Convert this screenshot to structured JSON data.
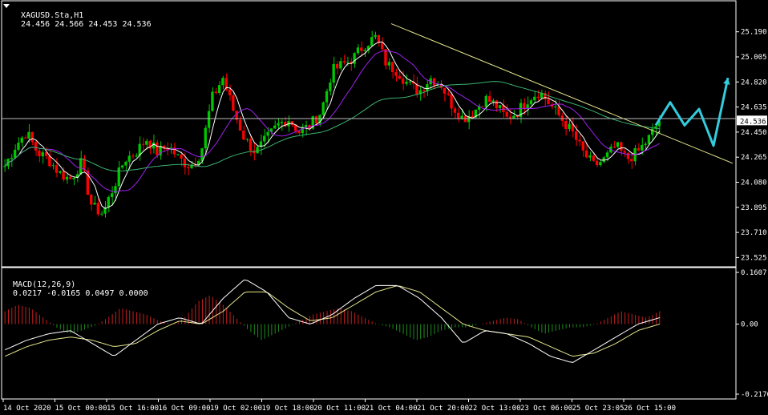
{
  "header": {
    "symbol": "XAGUSD.Sta,H1",
    "ohlc": "24.456 24.566 24.453 24.536"
  },
  "macd_header": {
    "label": "MACD(12,26,9)",
    "values": "0.0217 -0.0165 0.0497 0.0000"
  },
  "colors": {
    "background": "#000000",
    "bull_candle": "#00c800",
    "bear_candle": "#ff0000",
    "ma_fast": "#ffffff",
    "ma_mid": "#a020f0",
    "ma_slow": "#3cb371",
    "trendline": "#e6e68c",
    "forecast_arrow": "#33ccdd",
    "macd_hist_pos": "#c81e1e",
    "macd_hist_neg": "#1e8c1e",
    "macd_line": "#ffffff",
    "signal_line": "#e6e68c",
    "grid_axis": "#ffffff"
  },
  "chart_data": [
    {
      "type": "candlestick",
      "title": "XAGUSD.Sta,H1",
      "ylim": [
        23.48,
        25.33
      ],
      "yticks": [
        "25.190",
        "25.005",
        "24.820",
        "24.635",
        "24.450",
        "24.265",
        "24.080",
        "23.895",
        "23.710",
        "23.525"
      ],
      "current_price": "24.536",
      "close_path": [
        24.2,
        24.35,
        24.45,
        24.3,
        24.25,
        24.15,
        24.1,
        24.22,
        23.9,
        23.85,
        24.05,
        24.25,
        24.3,
        24.4,
        24.3,
        24.35,
        24.25,
        24.2,
        24.3,
        24.7,
        24.85,
        24.6,
        24.4,
        24.3,
        24.4,
        24.5,
        24.55,
        24.45,
        24.5,
        24.6,
        24.9,
        24.95,
        25.0,
        25.1,
        25.15,
        24.95,
        24.9,
        24.8,
        24.75,
        24.85,
        24.8,
        24.65,
        24.55,
        24.6,
        24.7,
        24.65,
        24.55,
        24.6,
        24.7,
        24.75,
        24.65,
        24.55,
        24.45,
        24.3,
        24.2,
        24.25,
        24.35,
        24.25,
        24.3,
        24.4,
        24.536
      ],
      "moving_averages": [
        "ma_fast",
        "ma_mid",
        "ma_slow"
      ],
      "trendline": {
        "from": [
          "21 Oct 04:00",
          25.25
        ],
        "to": [
          "26 Oct 15:00+",
          24.22
        ]
      },
      "horizontal_line": 24.55,
      "forecast_zigzag": [
        24.5,
        24.67,
        24.5,
        24.62,
        24.35,
        24.85
      ]
    },
    {
      "type": "bar",
      "title": "MACD(12,26,9)",
      "ylim": [
        -0.2176,
        0.1607
      ],
      "yticks": [
        "0.1607",
        "0.00",
        "-0.2176"
      ],
      "histogram": [
        0.04,
        0.06,
        0.05,
        0.02,
        -0.01,
        -0.03,
        -0.02,
        -0.005,
        0.02,
        0.05,
        0.04,
        0.03,
        0.01,
        0.0,
        0.02,
        0.07,
        0.09,
        0.06,
        0.02,
        -0.02,
        -0.05,
        -0.03,
        -0.01,
        0.01,
        0.03,
        0.04,
        0.05,
        0.04,
        0.02,
        0.0,
        -0.01,
        -0.03,
        -0.05,
        -0.04,
        -0.02,
        -0.01,
        -0.01,
        0.0,
        0.01,
        0.02,
        0.015,
        -0.01,
        -0.03,
        -0.02,
        -0.01,
        -0.01,
        0.0,
        0.02,
        0.04,
        0.03,
        0.02,
        0.04
      ],
      "macd_line": [
        -0.08,
        -0.05,
        -0.03,
        -0.02,
        -0.06,
        -0.1,
        -0.05,
        0.0,
        0.02,
        0.0,
        0.08,
        0.14,
        0.1,
        0.02,
        0.0,
        0.03,
        0.08,
        0.12,
        0.12,
        0.08,
        0.02,
        -0.06,
        -0.02,
        -0.03,
        -0.06,
        -0.1,
        -0.12,
        -0.08,
        -0.04,
        0.0,
        0.02
      ],
      "signal_line": [
        -0.1,
        -0.07,
        -0.05,
        -0.04,
        -0.05,
        -0.07,
        -0.06,
        -0.02,
        0.01,
        0.0,
        0.04,
        0.1,
        0.1,
        0.05,
        0.01,
        0.02,
        0.06,
        0.1,
        0.12,
        0.1,
        0.05,
        0.0,
        -0.02,
        -0.03,
        -0.04,
        -0.07,
        -0.1,
        -0.09,
        -0.06,
        -0.02,
        0.0
      ]
    }
  ],
  "x_labels": [
    "14 Oct 2020",
    "15 Oct 00:00",
    "15 Oct 16:00",
    "16 Oct 09:00",
    "19 Oct 02:00",
    "19 Oct 18:00",
    "20 Oct 11:00",
    "21 Oct 04:00",
    "21 Oct 20:00",
    "22 Oct 13:00",
    "23 Oct 06:00",
    "25 Oct 23:05",
    "26 Oct 15:00"
  ]
}
